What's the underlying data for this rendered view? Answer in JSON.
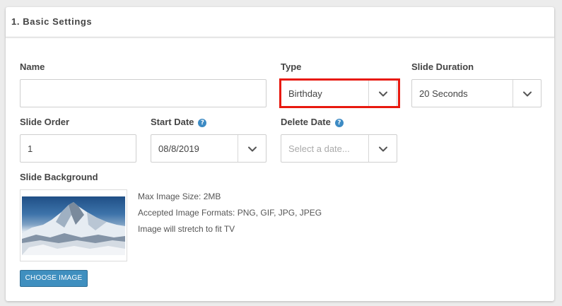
{
  "panel": {
    "title": "1. Basic Settings"
  },
  "form": {
    "name": {
      "label": "Name",
      "value": ""
    },
    "type": {
      "label": "Type",
      "value": "Birthday"
    },
    "slide_duration": {
      "label": "Slide Duration",
      "value": "20 Seconds"
    },
    "slide_order": {
      "label": "Slide Order",
      "value": "1"
    },
    "start_date": {
      "label": "Start Date",
      "value": "08/8/2019",
      "help": "?"
    },
    "delete_date": {
      "label": "Delete Date",
      "placeholder": "Select a date...",
      "help": "?"
    }
  },
  "background": {
    "label": "Slide Background",
    "info": [
      "Max Image Size: 2MB",
      "Accepted Image Formats: PNG, GIF, JPG, JPEG",
      "Image will stretch to fit TV"
    ],
    "button_label": "CHOOSE IMAGE"
  },
  "colors": {
    "accent": "#3f8fbf",
    "help_icon": "#3d8bc4",
    "highlight": "#e8190f"
  }
}
